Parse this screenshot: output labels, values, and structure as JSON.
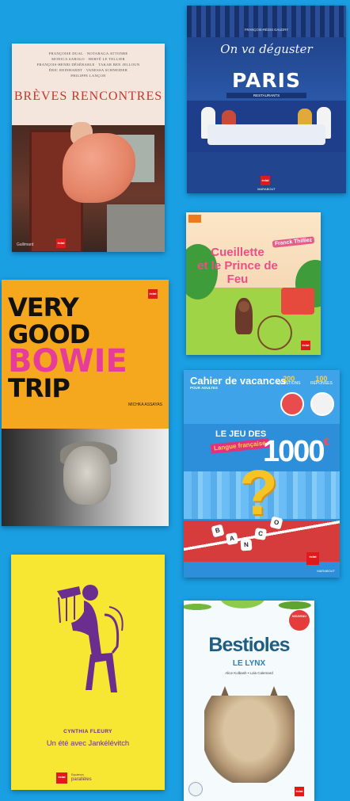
{
  "colors": {
    "background": "#1a9fe3",
    "badge": "#e1191a"
  },
  "badge_text": "éclat",
  "books": [
    {
      "id": "breves-rencontres",
      "authors": [
        "FRANÇOISE DUAL · NOTARAGA ATTONBE",
        "MONICA SABOLO · HERVÉ LE TELLIER",
        "FRANÇOIS-HENRI DÉSÉRABLE · TAKAR BEN JELLOUN",
        "ÉRIC REINHARDT · VANESSA SCHNEIDER",
        "PHILIPPE LANÇON"
      ],
      "title": "BRÈVES RENCONTRES",
      "publisher": "Gallimard"
    },
    {
      "id": "on-va-deguster-paris",
      "authors": "FRANÇOIS-RÉGIS GAUDRY",
      "title_line1": "On va déguster",
      "title_line2": "PARIS",
      "subtitle": "RESTAURANTS",
      "publisher": "MARABOUT"
    },
    {
      "id": "cueillette-prince-de-feu",
      "author": "Franck Thilliez",
      "title_line1": "Cueillette",
      "title_line2": "et le Prince de Feu"
    },
    {
      "id": "very-good-bowie-trip",
      "title_line1": "VERY",
      "title_line2": "GOOD",
      "title_line3": "BOWIE",
      "title_line4": "TRIP",
      "author": "MICHKA ASSAYAS"
    },
    {
      "id": "cahier-de-vacances-jeu-1000",
      "series": "Cahier de vacances",
      "series_sub": "POUR ADULTES",
      "stat1_value": "200",
      "stat1_label": "QUESTIONS",
      "stat2_value": "100",
      "stat2_label": "RÉPONSES",
      "title_prefix": "LE JEU DES",
      "title_badge": "Langue française",
      "title_number": "1000",
      "title_currency": "€",
      "tiles": [
        "B",
        "A",
        "N",
        "C",
        "O"
      ],
      "publisher": "MARABOUT"
    },
    {
      "id": "un-ete-avec-jankelevitch",
      "author": "CYNTHIA FLEURY",
      "title": "Un été avec Jankélévitch",
      "publisher": "parallèles",
      "publisher_sub": "Équateurs"
    },
    {
      "id": "bestioles-le-lynx",
      "title": "Bestioles",
      "subtitle": "LE LYNX",
      "authors": "Alice Kolbash • Lola Calemard",
      "sticker": "NOUVEAU"
    }
  ]
}
